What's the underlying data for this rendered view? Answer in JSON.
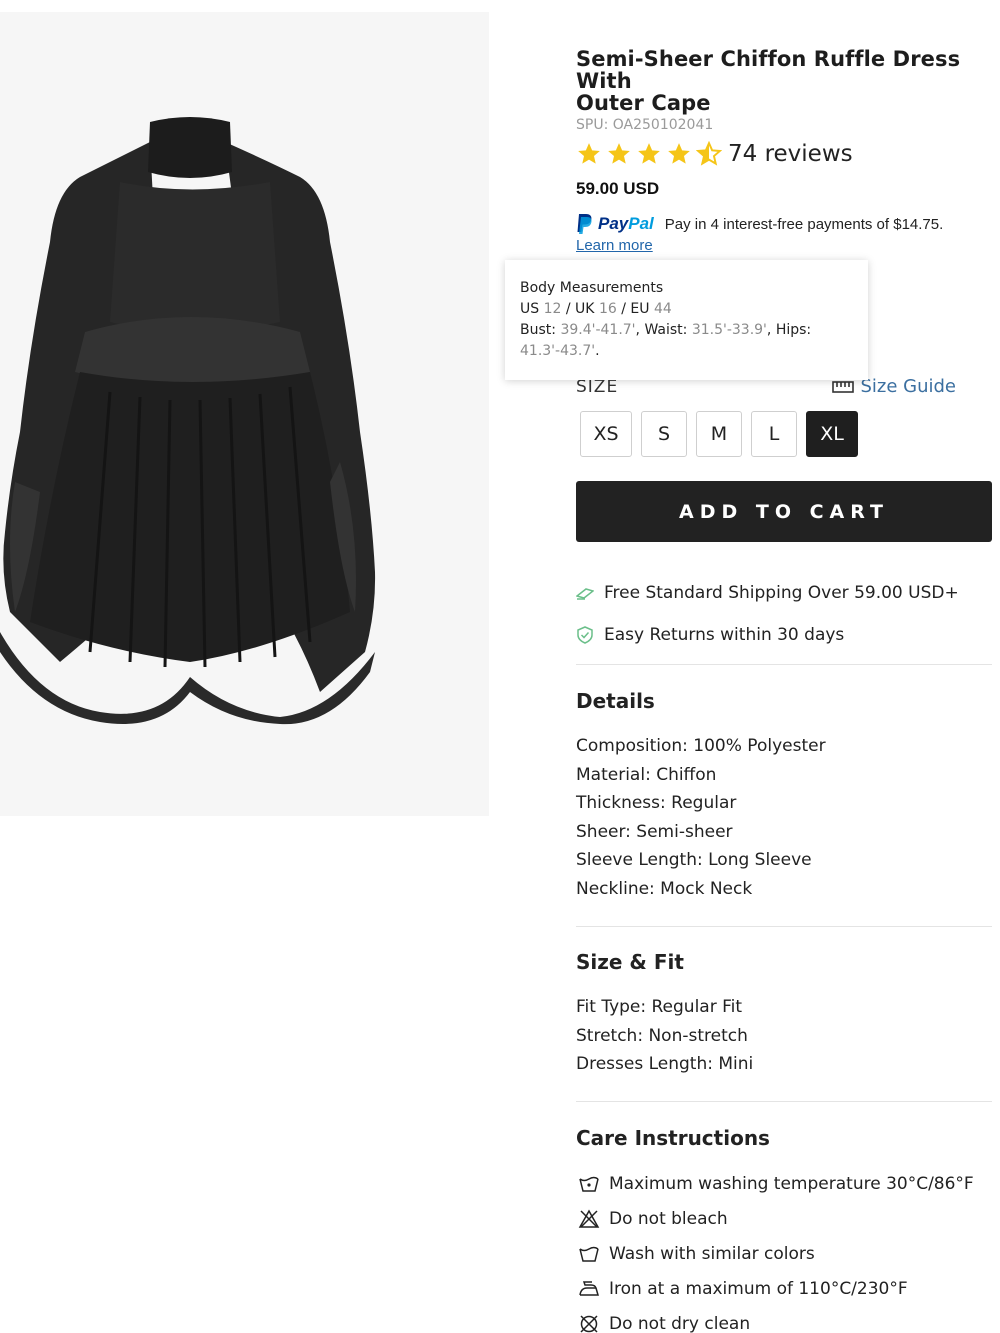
{
  "product": {
    "title_line1": "Semi-Sheer Chiffon Ruffle Dress With",
    "title_line2": "Outer Cape",
    "spu": "SPU: OA250102041",
    "rating": 4.5,
    "reviews": "74 reviews",
    "price": "59.00 USD"
  },
  "paypal": {
    "logo_part1": "Pay",
    "logo_part2": "Pal",
    "text": "Pay in 4 interest-free payments of $14.75.",
    "learn_more": "Learn more"
  },
  "tooltip": {
    "title": "Body Measurements",
    "us_label": "US",
    "us_value": "12",
    "uk_label": "UK",
    "uk_value": "16",
    "eu_label": "EU",
    "eu_value": "44",
    "sep": "/",
    "bust_label": "Bust:",
    "bust_value": "39.4'-41.7'",
    "waist_label": "Waist:",
    "waist_value": "31.5'-33.9'",
    "hips_label": "Hips:",
    "hips_value": "41.3'-43.7'"
  },
  "size": {
    "label": "SIZE",
    "guide": "Size Guide",
    "options": [
      "XS",
      "S",
      "M",
      "L",
      "XL"
    ],
    "selected": "XL"
  },
  "cart": {
    "label": "ADD TO CART"
  },
  "perks": {
    "shipping": "Free Standard Shipping Over 59.00 USD+",
    "returns": "Easy Returns within 30 days"
  },
  "details": {
    "title": "Details",
    "items": [
      "Composition: 100% Polyester",
      "Material: Chiffon",
      "Thickness: Regular",
      "Sheer: Semi-sheer",
      "Sleeve Length: Long Sleeve",
      "Neckline: Mock Neck"
    ]
  },
  "size_fit": {
    "title": "Size & Fit",
    "items": [
      "Fit Type: Regular Fit",
      "Stretch: Non-stretch",
      "Dresses Length: Mini"
    ]
  },
  "care": {
    "title": "Care Instructions",
    "items": [
      {
        "icon": "wash-30-icon",
        "text": "Maximum washing temperature 30°C/86°F"
      },
      {
        "icon": "no-bleach-icon",
        "text": "Do not bleach"
      },
      {
        "icon": "wash-tub-icon",
        "text": "Wash with similar colors"
      },
      {
        "icon": "iron-icon",
        "text": "Iron at a maximum of 110°C/230°F"
      },
      {
        "icon": "no-dry-clean-icon",
        "text": "Do not dry clean"
      }
    ]
  },
  "colors": {
    "accent_link": "#3b6fa0",
    "star": "#f5c518",
    "button_dark": "#222222",
    "perk_green": "#6bbf8a"
  }
}
